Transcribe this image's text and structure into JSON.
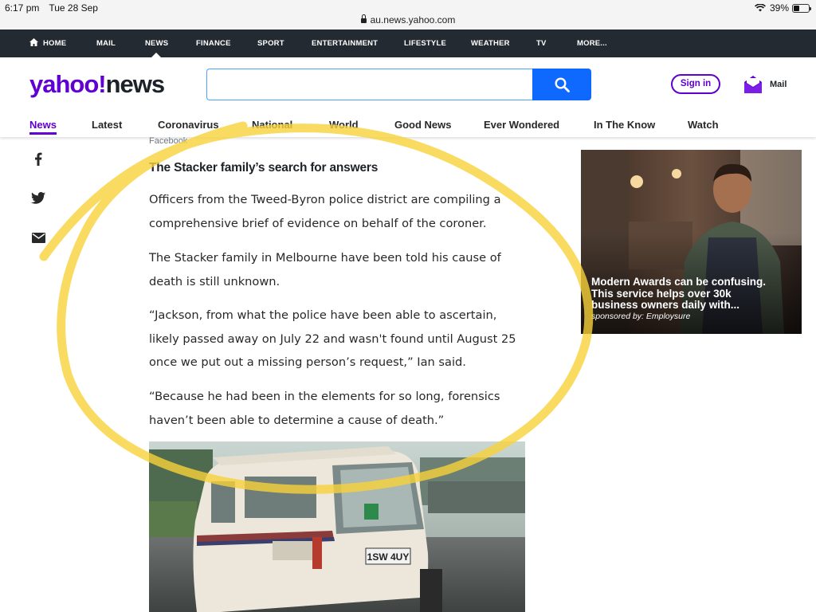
{
  "status_bar": {
    "time": "6:17 pm",
    "date": "Tue 28 Sep",
    "url": "au.news.yahoo.com",
    "battery_percent": "39%",
    "battery_level": 0.39
  },
  "top_nav": {
    "items": [
      "HOME",
      "MAIL",
      "NEWS",
      "FINANCE",
      "SPORT",
      "ENTERTAINMENT",
      "LIFESTYLE",
      "WEATHER",
      "TV",
      "MORE..."
    ],
    "active": "NEWS"
  },
  "header": {
    "logo_yahoo": "yahoo!",
    "logo_news": "news",
    "search_placeholder": "",
    "search_value": "",
    "signin_label": "Sign in",
    "mail_label": "Mail",
    "brand_color": "#6001d2",
    "search_button_color": "#0f69ff"
  },
  "section_nav": {
    "items": [
      "News",
      "Latest",
      "Coronavirus",
      "National",
      "World",
      "Good News",
      "Ever Wondered",
      "In The Know",
      "Watch"
    ],
    "active": "News"
  },
  "share": {
    "icons": [
      "facebook-icon",
      "twitter-icon",
      "email-icon"
    ]
  },
  "article": {
    "image_credit": "Facebook",
    "subhead": "The Stacker family’s search for answers",
    "paragraphs": [
      [
        "Officers from the Tweed-Byron police district are compiling a",
        "comprehensive brief of evidence on behalf of the coroner."
      ],
      [
        "The Stacker family in Melbourne have been told his cause of",
        "death is still unknown."
      ],
      [
        "“Jackson, from what the police have been able to ascertain,",
        "likely passed away on July 22 and wasn't found until August 25",
        "once we put out a missing person’s request,” Ian said."
      ],
      [
        "“Because he had been in the elements for so long, forensics",
        "haven’t been able to determine a cause of death.”"
      ]
    ],
    "photo_plate": "1SW 4UY"
  },
  "ad": {
    "headline": "Modern Awards can be confusing. This service helps over 30k business owners daily with...",
    "headline_lines": [
      "Modern Awards can be confusing.",
      "This service helps over 30k",
      "business owners daily with..."
    ],
    "sponsor": "sponsored by: Employsure"
  },
  "annotation": {
    "highlight_color": "#f7d23a"
  }
}
